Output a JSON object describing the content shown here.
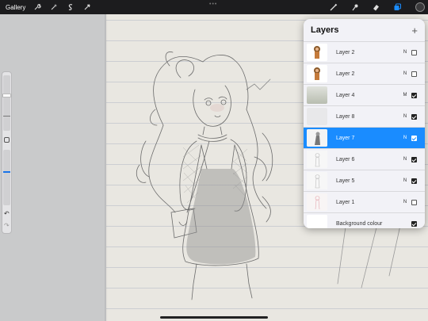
{
  "topbar": {
    "gallery_label": "Gallery",
    "left_tools": [
      "wrench-icon",
      "magic-wand-icon",
      "selection-s-icon",
      "transform-arrow-icon"
    ],
    "right_tools": [
      "brush-icon",
      "smudge-icon",
      "eraser-icon",
      "layers-icon"
    ],
    "accent_color": "#1a8cff"
  },
  "sidebar": {
    "undo_label": "↶",
    "redo_label": "↷"
  },
  "layers": {
    "title": "Layers",
    "add_label": "+",
    "rows": [
      {
        "name": "Layer 2",
        "blend": "N",
        "visible": false,
        "selected": false,
        "thumb": "character-color"
      },
      {
        "name": "Layer 2",
        "blend": "N",
        "visible": false,
        "selected": false,
        "thumb": "character-color"
      },
      {
        "name": "Layer 4",
        "blend": "M",
        "visible": true,
        "selected": false,
        "thumb": "gradient"
      },
      {
        "name": "Layer 8",
        "blend": "N",
        "visible": true,
        "selected": false,
        "thumb": "blank"
      },
      {
        "name": "Layer 7",
        "blend": "N",
        "visible": true,
        "selected": true,
        "thumb": "sketch-dark"
      },
      {
        "name": "Layer 6",
        "blend": "N",
        "visible": true,
        "selected": false,
        "thumb": "sketch-light"
      },
      {
        "name": "Layer 5",
        "blend": "N",
        "visible": true,
        "selected": false,
        "thumb": "sketch-light"
      },
      {
        "name": "Layer 1",
        "blend": "N",
        "visible": false,
        "selected": false,
        "thumb": "sketch-pink"
      },
      {
        "name": "Background colour",
        "blend": "",
        "visible": true,
        "selected": false,
        "thumb": "white"
      }
    ]
  }
}
